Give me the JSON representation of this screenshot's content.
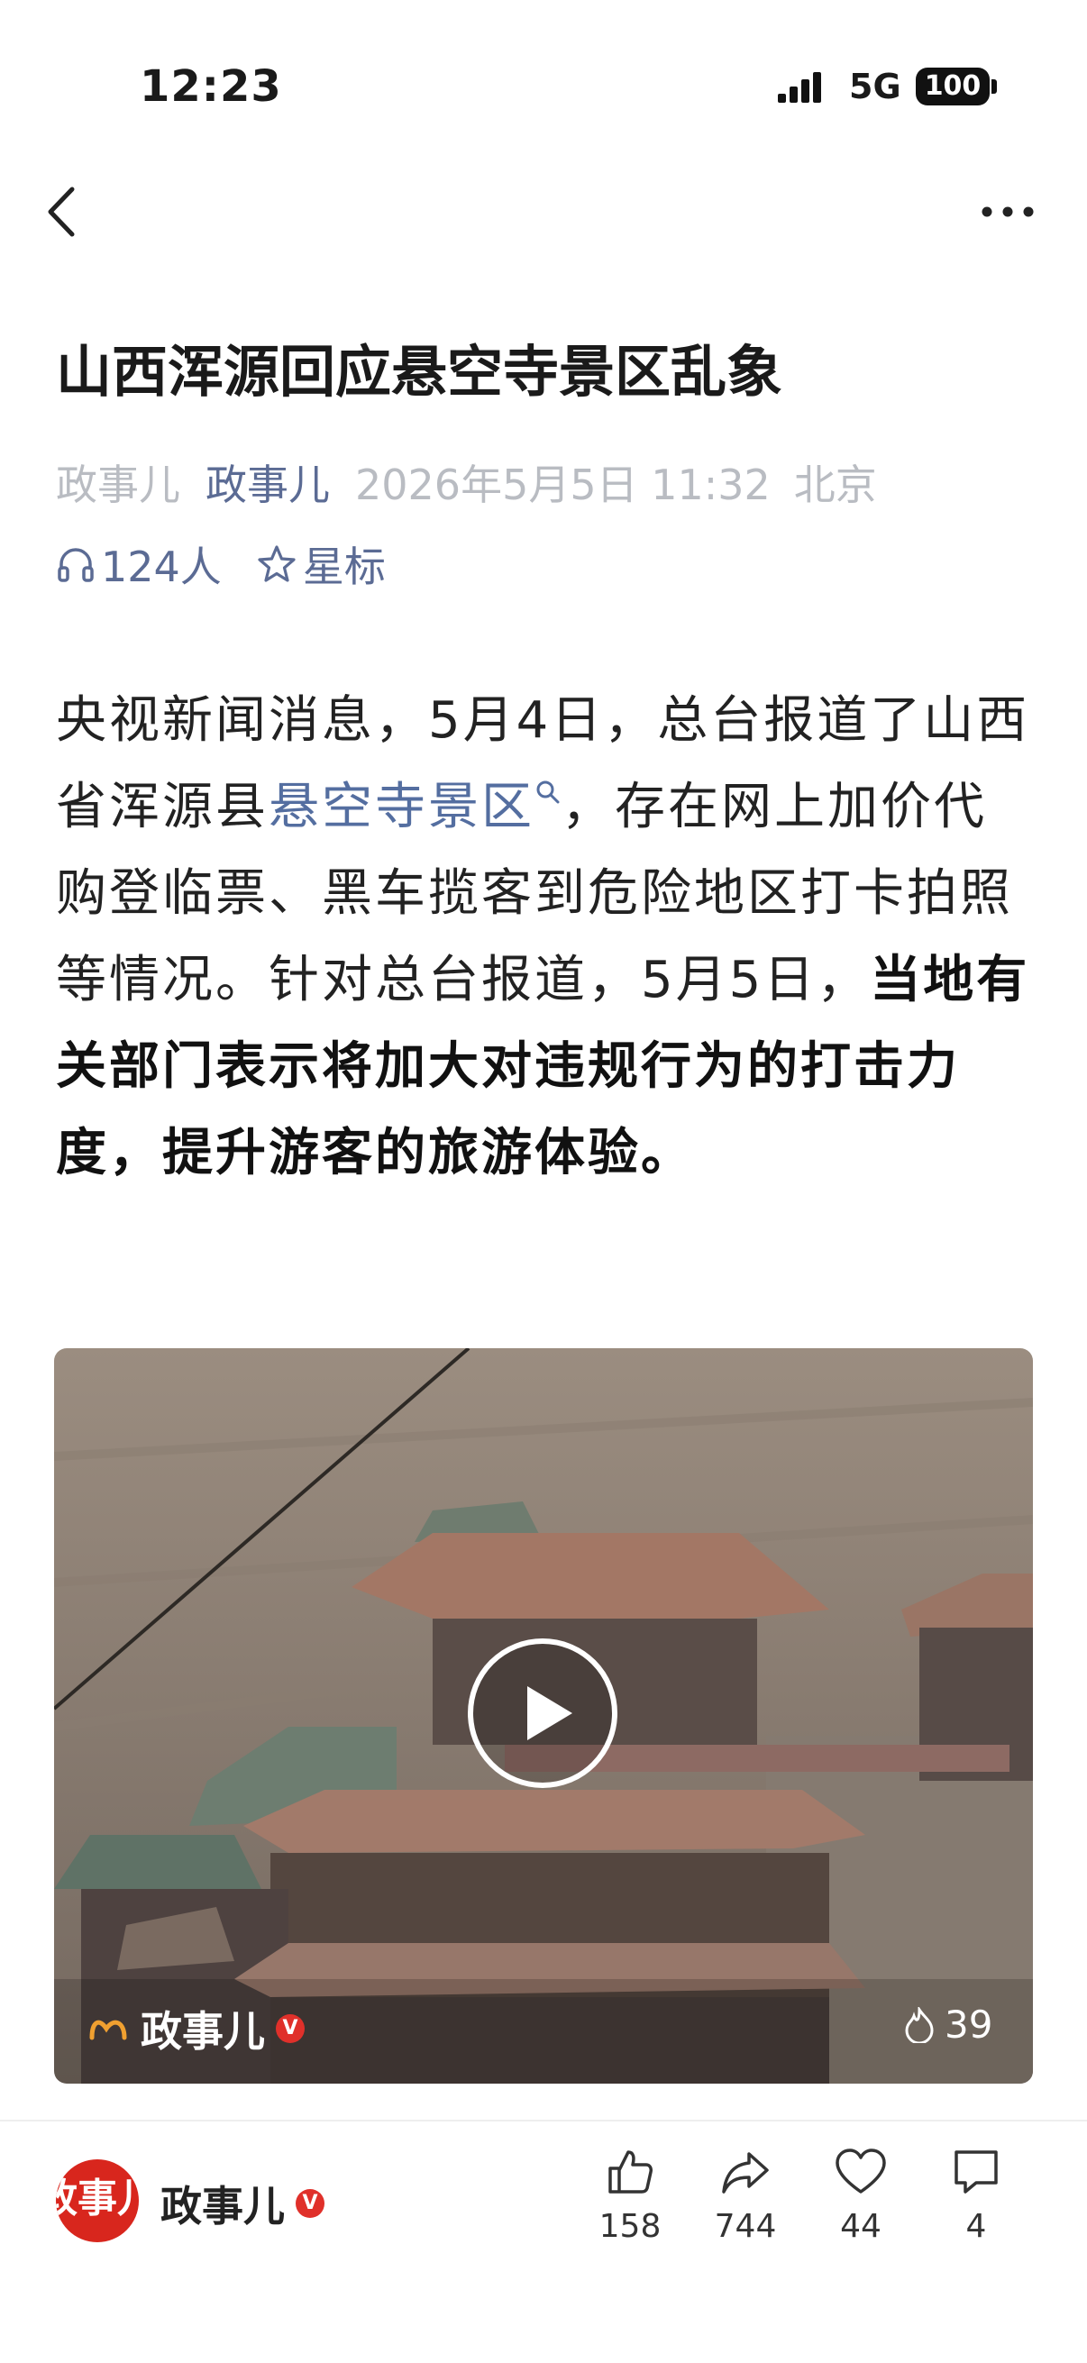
{
  "status": {
    "time": "12:23",
    "network": "5G",
    "battery": "100"
  },
  "article": {
    "title": "山西浑源回应悬空寺景区乱象",
    "source1": "政事儿",
    "source2": "政事儿",
    "date": "2026年5月5日 11:32",
    "location": "北京",
    "listeners": "124人",
    "star_label": "星标",
    "body_part1": "央视新闻消息，5月4日，总台报道了山西省浑源县",
    "body_link": "悬空寺景区",
    "body_part2": "，存在网上加价代购登临票、黑车揽客到危险地区打卡拍照等情况。针对总台报道，5月5日，",
    "body_bold": "当地有关部门表示将加大对违规行为的打击力度，提升游客的旅游体验。"
  },
  "video": {
    "source": "政事儿",
    "views": "39"
  },
  "author": {
    "name": "政事儿",
    "badge": "V",
    "avatar_text": "政事儿"
  },
  "actions": {
    "like": "158",
    "share": "744",
    "favorite": "44",
    "comment": "4"
  }
}
